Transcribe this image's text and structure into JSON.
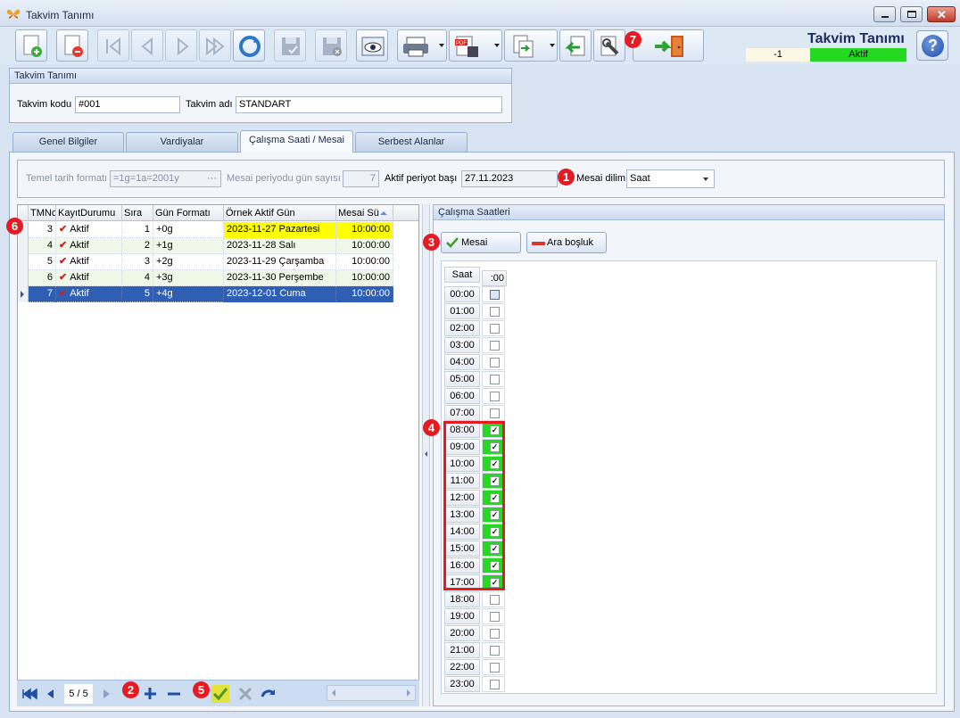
{
  "window": {
    "title": "Takvim Tanımı"
  },
  "header": {
    "title": "Takvim Tanımı",
    "value": "-1",
    "status": "Aktif",
    "status_color": "#25d923"
  },
  "toolbar_icons": [
    "new-record-icon",
    "delete-record-icon",
    "first-record-icon",
    "previous-record-icon",
    "next-record-icon",
    "last-record-icon",
    "refresh-icon",
    "save-icon",
    "save-close-icon",
    "preview-icon",
    "print-icon",
    "pdf-export-icon",
    "export-icon",
    "back-icon",
    "tools-icon",
    "exit-door-icon",
    "help-icon"
  ],
  "group": {
    "caption": "Takvim Tanımı",
    "code_label": "Takvim kodu",
    "code_value": "#001",
    "name_label": "Takvim adı",
    "name_value": "STANDART"
  },
  "tabs": [
    "Genel Bilgiler",
    "Vardiyalar",
    "Çalışma Saati / Mesai",
    "Serbest Alanlar"
  ],
  "settings": {
    "date_format_label": "Temel tarih formatı",
    "date_format_value": "=1g=1a=2001y",
    "period_days_label": "Mesai periyodu gün sayısı",
    "period_days_value": "7",
    "period_start_label": "Aktif periyot başı",
    "period_start_value": "27.11.2023",
    "slice_label": "Mesai dilim",
    "slice_value": "Saat"
  },
  "grid": {
    "columns": [
      "TMNo",
      "KayıtDurumu",
      "Sıra",
      "Gün Formatı",
      "Örnek Aktif Gün",
      "Mesai Sü"
    ],
    "rows": [
      {
        "tmno": "3",
        "status": "Aktif",
        "order": "1",
        "format": "+0g",
        "sample": "2023-11-27 Pazartesi",
        "duration": "10:00:00"
      },
      {
        "tmno": "4",
        "status": "Aktif",
        "order": "2",
        "format": "+1g",
        "sample": "2023-11-28 Salı",
        "duration": "10:00:00"
      },
      {
        "tmno": "5",
        "status": "Aktif",
        "order": "3",
        "format": "+2g",
        "sample": "2023-11-29 Çarşamba",
        "duration": "10:00:00"
      },
      {
        "tmno": "6",
        "status": "Aktif",
        "order": "4",
        "format": "+3g",
        "sample": "2023-11-30 Perşembe",
        "duration": "10:00:00"
      },
      {
        "tmno": "7",
        "status": "Aktif",
        "order": "5",
        "format": "+4g",
        "sample": "2023-12-01 Cuma",
        "duration": "10:00:00"
      }
    ],
    "highlight_color": "#ffff00",
    "selected_color": "#2f5fb3"
  },
  "navigator": {
    "page": "5 / 5"
  },
  "right_panel": {
    "caption": "Çalışma Saatleri",
    "mesai_button": "Mesai",
    "break_button": "Ara boşluk",
    "hour_header": "Saat",
    "minute_header": ":00",
    "hours": [
      "00:00",
      "01:00",
      "02:00",
      "03:00",
      "04:00",
      "05:00",
      "06:00",
      "07:00",
      "08:00",
      "09:00",
      "10:00",
      "11:00",
      "12:00",
      "13:00",
      "14:00",
      "15:00",
      "16:00",
      "17:00",
      "18:00",
      "19:00",
      "20:00",
      "21:00",
      "22:00",
      "23:00"
    ],
    "checked": [
      false,
      false,
      false,
      false,
      false,
      false,
      false,
      false,
      true,
      true,
      true,
      true,
      true,
      true,
      true,
      true,
      true,
      true,
      false,
      false,
      false,
      false,
      false,
      false
    ]
  },
  "badges": [
    "1",
    "2",
    "3",
    "4",
    "5",
    "6",
    "7"
  ]
}
